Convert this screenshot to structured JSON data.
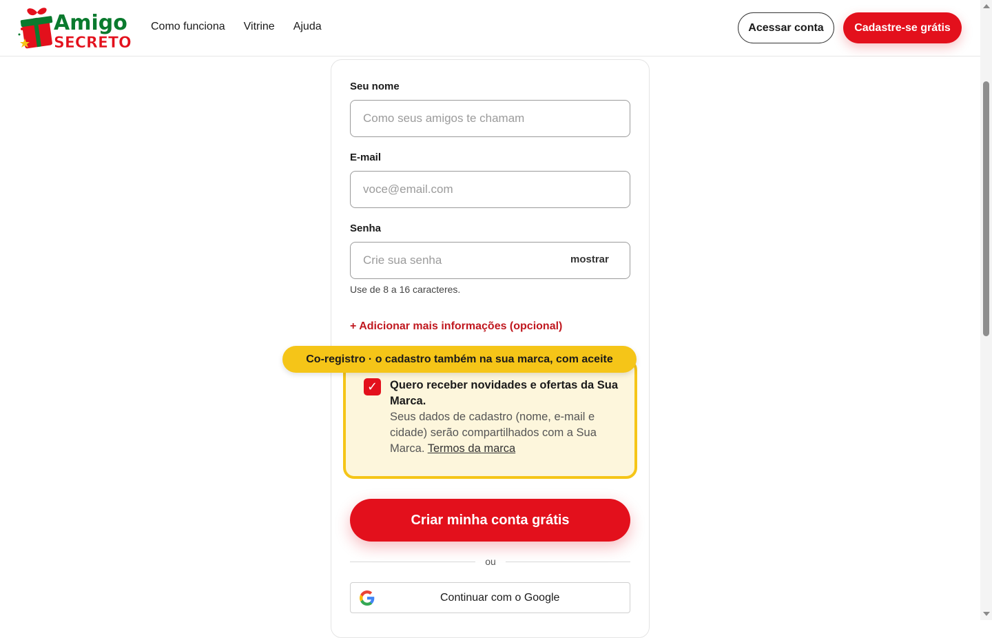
{
  "header": {
    "logo_text_top": "Amigo",
    "logo_text_bottom": "SECRETO",
    "nav": [
      "Como funciona",
      "Vitrine",
      "Ajuda"
    ],
    "login_label": "Acessar conta",
    "signup_label": "Cadastre-se grátis"
  },
  "form": {
    "name_label": "Seu nome",
    "name_placeholder": "Como seus amigos te chamam",
    "email_label": "E-mail",
    "email_placeholder": "voce@email.com",
    "password_label": "Senha",
    "password_placeholder": "Crie sua senha",
    "show_label": "mostrar",
    "password_hint": "Use de 8 a 16 caracteres.",
    "add_info": "+ Adicionar mais informações (opcional)"
  },
  "coregistro": {
    "badge": "Co-registro · o cadastro também na sua marca, com aceite",
    "checked": true,
    "check_glyph": "✓",
    "title": "Quero receber novidades e ofertas da Sua Marca.",
    "body": "Seus dados de cadastro (nome, e-mail e cidade) serão compartilhados com a Sua Marca.",
    "terms_link": "Termos da marca"
  },
  "actions": {
    "create_label": "Criar minha conta grátis",
    "or_label": "ou",
    "google_label": "Continuar com o Google"
  },
  "colors": {
    "brand_red": "#e3101c",
    "brand_green": "#0a7a2e",
    "highlight_yellow": "#f5c518"
  }
}
